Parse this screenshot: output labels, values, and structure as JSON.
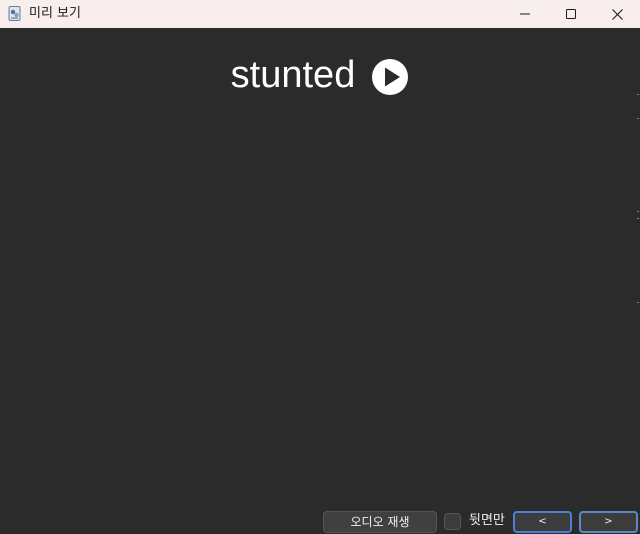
{
  "window": {
    "title": "미리 보기",
    "app_icon": "app-doc-icon",
    "controls": {
      "minimize_icon": "minimize-icon",
      "maximize_icon": "maximize-icon",
      "close_icon": "close-icon"
    }
  },
  "preview": {
    "word": "stunted",
    "play_icon": "play-circle-icon"
  },
  "bottom_bar": {
    "audio_button_label": "오디오 재생",
    "back_only_label": "뒷면만",
    "back_only_checked": false,
    "prev_label": "<",
    "next_label": ">"
  },
  "colors": {
    "background": "#2b2b2b",
    "titlebar": "#f9eeee",
    "accent": "#4a7fd6",
    "text": "#ffffff"
  }
}
